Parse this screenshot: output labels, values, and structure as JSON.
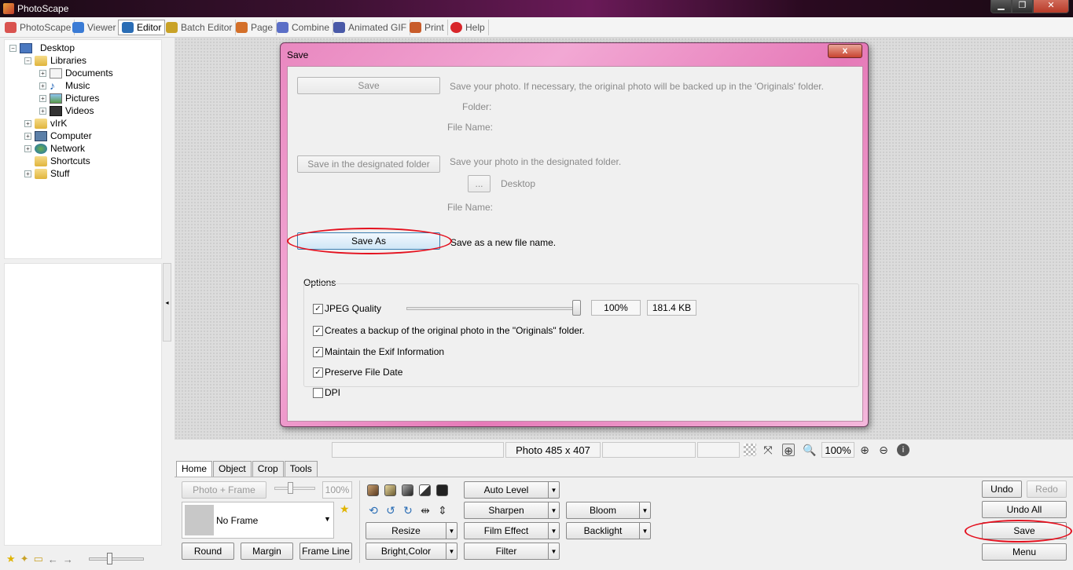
{
  "app": {
    "title": "PhotoScape"
  },
  "window_controls": {
    "minimize": "▁",
    "maximize": "❐",
    "close": "✕"
  },
  "main_tabs": [
    {
      "label": "PhotoScape",
      "icon": "photoscape-icon",
      "color": "#d9534f"
    },
    {
      "label": "Viewer",
      "icon": "viewer-icon",
      "color": "#3a7bd5"
    },
    {
      "label": "Editor",
      "icon": "editor-icon",
      "color": "#2a6db5"
    },
    {
      "label": "Batch Editor",
      "icon": "batch-editor-icon",
      "color": "#c9a227"
    },
    {
      "label": "Page",
      "icon": "page-icon",
      "color": "#d4702a"
    },
    {
      "label": "Combine",
      "icon": "combine-icon",
      "color": "#5b6fc7"
    },
    {
      "label": "Animated GIF",
      "icon": "animated-gif-icon",
      "color": "#4a5aa8"
    },
    {
      "label": "Print",
      "icon": "print-icon",
      "color": "#c85c2a"
    },
    {
      "label": "Help",
      "icon": "help-icon",
      "color": "#d8262a"
    }
  ],
  "tree": [
    {
      "label": "Desktop",
      "icon": "desktop-icon"
    },
    {
      "label": "Libraries",
      "icon": "libraries-icon"
    },
    {
      "label": "Documents",
      "icon": "documents-icon"
    },
    {
      "label": "Music",
      "icon": "music-icon"
    },
    {
      "label": "Pictures",
      "icon": "pictures-icon"
    },
    {
      "label": "Videos",
      "icon": "videos-icon"
    },
    {
      "label": "vIrK",
      "icon": "folder-icon"
    },
    {
      "label": "Computer",
      "icon": "computer-icon"
    },
    {
      "label": "Network",
      "icon": "network-icon"
    },
    {
      "label": "Shortcuts",
      "icon": "folder-icon"
    },
    {
      "label": "Stuff",
      "icon": "folder-icon"
    }
  ],
  "status_bar": {
    "photo_size": "Photo 485 x 407",
    "zoom": "100%"
  },
  "bottom_tabs": [
    "Home",
    "Object",
    "Crop",
    "Tools"
  ],
  "home_panel": {
    "photo_frame_label": "Photo + Frame",
    "frame_percent": "100%",
    "frame_name": "No Frame",
    "round_label": "Round",
    "margin_label": "Margin",
    "frame_line_label": "Frame Line",
    "auto_level_label": "Auto Level",
    "sharpen_label": "Sharpen",
    "film_effect_label": "Film Effect",
    "filter_label": "Filter",
    "resize_label": "Resize",
    "bright_color_label": "Bright,Color",
    "bloom_label": "Bloom",
    "backlight_label": "Backlight"
  },
  "right_panel": {
    "undo_label": "Undo",
    "redo_label": "Redo",
    "undo_all_label": "Undo All",
    "save_label": "Save",
    "menu_label": "Menu"
  },
  "dialog": {
    "title": "Save",
    "close_symbol": "x",
    "save_label": "Save",
    "save_desc": "Save your photo. If necessary, the original photo will be backed up in the 'Originals' folder.",
    "folder_label": "Folder:",
    "file_name_label": "File Name:",
    "save_designated_label": "Save in the designated folder",
    "save_designated_desc": "Save your photo in the designated folder.",
    "browse_label": "...",
    "designated_folder": "Desktop",
    "file_name_label_2": "File Name:",
    "save_as_label": "Save As",
    "save_as_desc": "Save as a new file name.",
    "options_label": "Options",
    "jpeg_quality_label": "JPEG Quality",
    "jpeg_quality_fraction": 1.0,
    "jpeg_quality_value": "100%",
    "file_size": "181.4 KB",
    "backup_label": "Creates a backup of the original photo in the \"Originals\" folder.",
    "exif_label": "Maintain the Exif Information",
    "preserve_date_label": "Preserve File Date",
    "dpi_label": "DPI",
    "checks": {
      "jpeg_quality": true,
      "backup": true,
      "exif": true,
      "preserve_date": true,
      "dpi": false
    }
  },
  "annotation_color": "#e4101e"
}
